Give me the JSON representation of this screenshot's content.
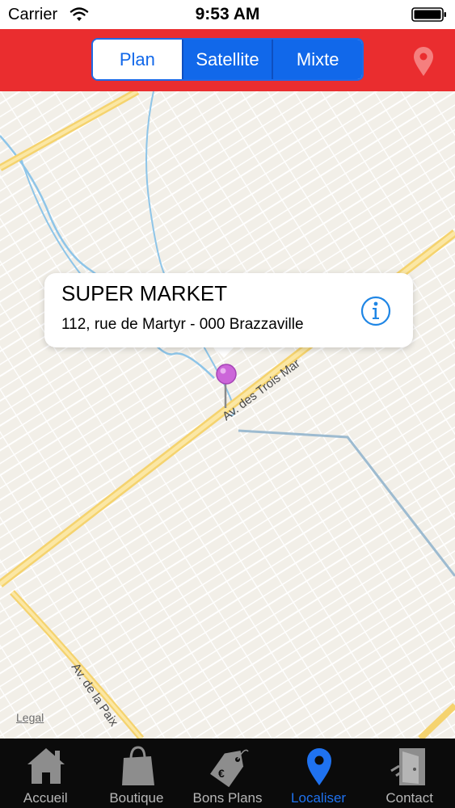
{
  "status_bar": {
    "carrier": "Carrier",
    "time": "9:53 AM"
  },
  "nav_bar": {
    "segments": [
      {
        "label": "Plan",
        "selected": true
      },
      {
        "label": "Satellite",
        "selected": false
      },
      {
        "label": "Mixte",
        "selected": false
      }
    ],
    "pin_icon": "location-pin-icon"
  },
  "map": {
    "street_labels": [
      "Av. des Trois Mar",
      "Av. de la Paix"
    ],
    "legal": "Legal",
    "marker_color": "#cc66d9"
  },
  "callout": {
    "title": "SUPER MARKET",
    "subtitle": "112, rue de Martyr - 000 Brazzaville",
    "info_icon": "info-icon"
  },
  "tab_bar": {
    "items": [
      {
        "label": "Accueil",
        "icon": "home-icon",
        "active": false
      },
      {
        "label": "Boutique",
        "icon": "shopping-bag-icon",
        "active": false
      },
      {
        "label": "Bons Plans",
        "icon": "price-tag-icon",
        "active": false
      },
      {
        "label": "Localiser",
        "icon": "location-pin-icon",
        "active": true
      },
      {
        "label": "Contact",
        "icon": "door-exit-icon",
        "active": false
      }
    ]
  },
  "colors": {
    "nav_red": "#ea2d2f",
    "segment_blue": "#1168ea",
    "active_tab_blue": "#1f72f0",
    "map_background": "#f2efe8",
    "road_yellow": "#f5d36e",
    "water_blue": "#8ec5e8"
  }
}
